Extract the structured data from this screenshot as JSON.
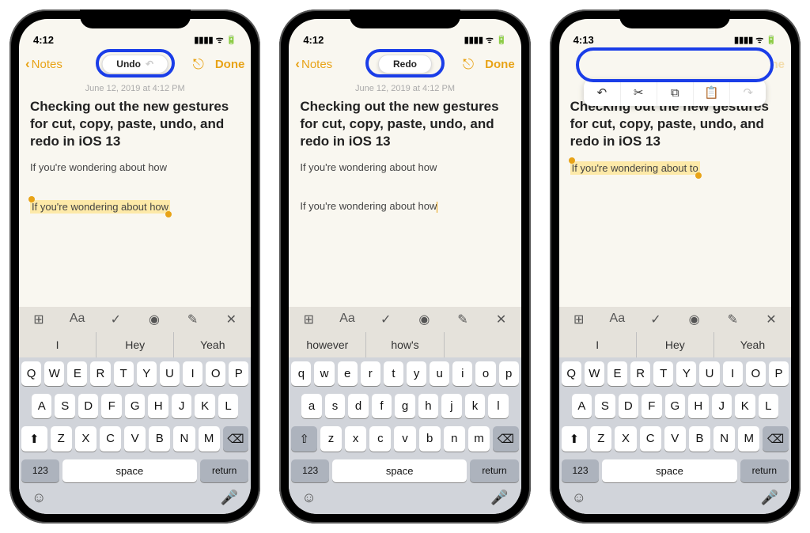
{
  "statusbar": {
    "time1": "4:12",
    "time2": "4:12",
    "time3": "4:13"
  },
  "nav": {
    "back": "Notes",
    "done": "Done",
    "undo_label": "Undo",
    "redo_label": "Redo"
  },
  "timestamp": "June 12, 2019 at 4:12 PM",
  "note": {
    "title": "Checking out the new gestures for cut, copy, paste, undo, and redo in  iOS 13",
    "line1": "If you're wondering about how",
    "line2_selected": "If you're wondering about how",
    "line3_short": "If you're wondering about to"
  },
  "suggestions_a": [
    "I",
    "Hey",
    "Yeah"
  ],
  "suggestions_b": [
    "however",
    "how's",
    ""
  ],
  "keys_upper": {
    "r1": [
      "Q",
      "W",
      "E",
      "R",
      "T",
      "Y",
      "U",
      "I",
      "O",
      "P"
    ],
    "r2": [
      "A",
      "S",
      "D",
      "F",
      "G",
      "H",
      "J",
      "K",
      "L"
    ],
    "r3": [
      "Z",
      "X",
      "C",
      "V",
      "B",
      "N",
      "M"
    ]
  },
  "keys_lower": {
    "r1": [
      "q",
      "w",
      "e",
      "r",
      "t",
      "y",
      "u",
      "i",
      "o",
      "p"
    ],
    "r2": [
      "a",
      "s",
      "d",
      "f",
      "g",
      "h",
      "j",
      "k",
      "l"
    ],
    "r3": [
      "z",
      "x",
      "c",
      "v",
      "b",
      "n",
      "m"
    ]
  },
  "kb_labels": {
    "num": "123",
    "space": "space",
    "ret": "return"
  },
  "edit_icons": [
    "↶",
    "✂︎",
    "⧉",
    "📋",
    "↷"
  ]
}
